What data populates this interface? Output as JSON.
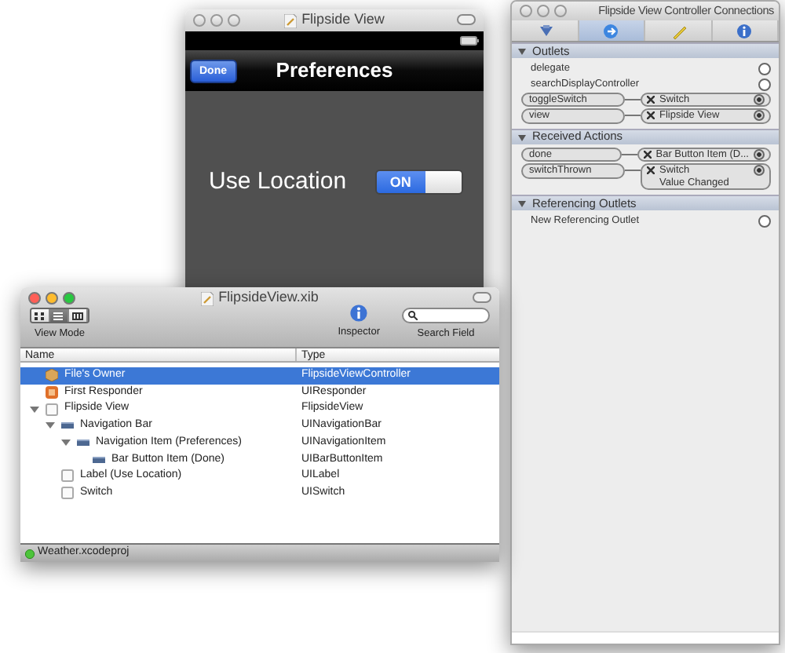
{
  "flipside_window": {
    "title": "Flipside View",
    "active": false,
    "done_button": "Done",
    "nav_title": "Preferences",
    "label": "Use Location",
    "switch": {
      "label": "ON",
      "on": true
    }
  },
  "connections_window": {
    "title": "Flipside View Controller Connections",
    "active": false,
    "tabs": [
      {
        "selected": false
      },
      {
        "selected": true
      },
      {
        "selected": false
      },
      {
        "selected": false
      }
    ],
    "sections": [
      {
        "title": "Outlets",
        "expanded": true,
        "rows": [
          {
            "name": "delegate",
            "connected": false
          },
          {
            "name": "searchDisplayController",
            "connected": false
          },
          {
            "name": "toggleSwitch",
            "connected": true,
            "target": "Switch"
          },
          {
            "name": "view",
            "connected": true,
            "target": "Flipside View"
          }
        ]
      },
      {
        "title": "Received Actions",
        "expanded": true,
        "rows": [
          {
            "name": "done",
            "connected": true,
            "target": "Bar Button Item (D..."
          },
          {
            "name": "switchThrown",
            "connected": true,
            "target": "Switch",
            "event": "Value Changed"
          }
        ]
      },
      {
        "title": "Referencing Outlets",
        "expanded": true,
        "rows": [
          {
            "name": "New Referencing Outlet",
            "connected": false
          }
        ]
      }
    ]
  },
  "xib_window": {
    "title": "FlipsideView.xib",
    "active": true,
    "view_modes": [
      {
        "selected": false
      },
      {
        "selected": true
      },
      {
        "selected": false
      }
    ],
    "view_mode_label": "View Mode",
    "inspector_label": "Inspector",
    "search_label": "Search Field",
    "columns": [
      "Name",
      "Type"
    ],
    "tree": [
      {
        "name": "File's Owner",
        "type": "FlipsideViewController",
        "kind": "owner",
        "selected": true
      },
      {
        "name": "First Responder",
        "type": "UIResponder",
        "kind": "responder",
        "selected": false
      },
      {
        "name": "Flipside View",
        "type": "FlipsideView",
        "kind": "view",
        "selected": false,
        "expanded": true,
        "children": [
          {
            "name": "Navigation Bar",
            "type": "UINavigationBar",
            "kind": "navbar",
            "selected": false,
            "expanded": true,
            "children": [
              {
                "name": "Navigation Item (Preferences)",
                "type": "UINavigationItem",
                "kind": "navbar",
                "selected": false,
                "expanded": true,
                "children": [
                  {
                    "name": "Bar Button Item (Done)",
                    "type": "UIBarButtonItem",
                    "kind": "navbar",
                    "selected": false
                  }
                ]
              }
            ]
          },
          {
            "name": "Label (Use Location)",
            "type": "UILabel",
            "kind": "view",
            "selected": false
          },
          {
            "name": "Switch",
            "type": "UISwitch",
            "kind": "view",
            "selected": false
          }
        ]
      }
    ],
    "status": "Weather.xcodeproj"
  }
}
